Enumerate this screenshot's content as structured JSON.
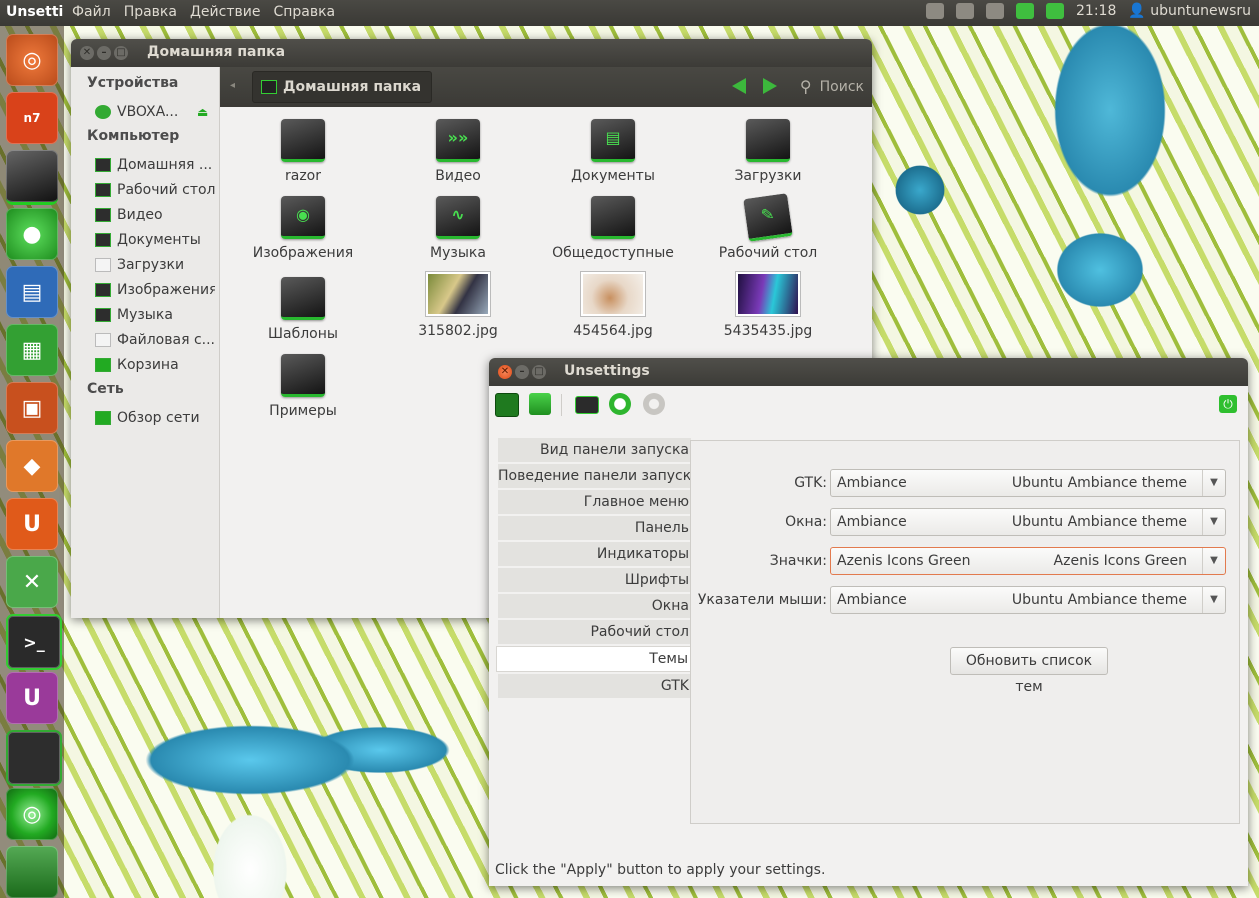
{
  "top_panel": {
    "app_name": "Unsetti",
    "menu": [
      "Файл",
      "Правка",
      "Действие",
      "Справка"
    ],
    "clock": "21:18",
    "user": "ubuntunewsru"
  },
  "launcher": {
    "items": [
      {
        "icon": "ubuntu-dash-icon",
        "label": ""
      },
      {
        "icon": "nexus7-icon",
        "label": "n7"
      },
      {
        "icon": "home-folder-icon",
        "label": ""
      },
      {
        "icon": "browser-icon",
        "label": ""
      },
      {
        "icon": "writer-icon",
        "label": ""
      },
      {
        "icon": "calc-icon",
        "label": ""
      },
      {
        "icon": "impress-icon",
        "label": ""
      },
      {
        "icon": "software-center-icon",
        "label": ""
      },
      {
        "icon": "ubuntu-one-icon",
        "label": "U"
      },
      {
        "icon": "system-settings-icon",
        "label": ""
      },
      {
        "icon": "terminal-icon",
        "label": ">_"
      },
      {
        "icon": "unsettings-icon",
        "label": "U"
      },
      {
        "icon": "workspace-icon",
        "label": ""
      },
      {
        "icon": "dvd-icon",
        "label": ""
      },
      {
        "icon": "trash-icon",
        "label": ""
      }
    ]
  },
  "file_manager": {
    "title": "Домашняя папка",
    "breadcrumb": "Домашняя папка",
    "search_label": "Поиск",
    "sidebar": {
      "devices_header": "Устройства",
      "devices": [
        "VBOXA..."
      ],
      "computer_header": "Компьютер",
      "computer": [
        "Домашняя ...",
        "Рабочий стол",
        "Видео",
        "Документы",
        "Загрузки",
        "Изображения",
        "Музыка",
        "Файловая с...",
        "Корзина"
      ],
      "network_header": "Сеть",
      "network": [
        "Обзор сети"
      ]
    },
    "files": [
      {
        "name": "razor",
        "kind": "folder",
        "glyph": ""
      },
      {
        "name": "Видео",
        "kind": "folder",
        "glyph": "»»"
      },
      {
        "name": "Документы",
        "kind": "folder",
        "glyph": "▤"
      },
      {
        "name": "Загрузки",
        "kind": "folder",
        "glyph": ""
      },
      {
        "name": "Изображения",
        "kind": "folder",
        "glyph": "◉"
      },
      {
        "name": "Музыка",
        "kind": "folder",
        "glyph": "∿"
      },
      {
        "name": "Общедоступные",
        "kind": "folder",
        "glyph": ""
      },
      {
        "name": "Рабочий стол",
        "kind": "folder",
        "glyph": "✎"
      },
      {
        "name": "Шаблоны",
        "kind": "folder",
        "glyph": ""
      },
      {
        "name": "315802.jpg",
        "kind": "image",
        "glyph": ""
      },
      {
        "name": "454564.jpg",
        "kind": "image",
        "glyph": ""
      },
      {
        "name": "5435435.jpg",
        "kind": "image",
        "glyph": ""
      },
      {
        "name": "Примеры",
        "kind": "folder",
        "glyph": ""
      }
    ]
  },
  "unsettings": {
    "title": "Unsettings",
    "categories": [
      "Вид панели запуска",
      "Поведение панели запуска",
      "Главное меню",
      "Панель",
      "Индикаторы",
      "Шрифты",
      "Окна",
      "Рабочий стол",
      "Темы",
      "GTK"
    ],
    "selected_category": "Темы",
    "theme_rows": [
      {
        "label": "GTK:",
        "value": "Ambiance",
        "description": "Ubuntu Ambiance theme"
      },
      {
        "label": "Окна:",
        "value": "Ambiance",
        "description": "Ubuntu Ambiance theme"
      },
      {
        "label": "Значки:",
        "value": "Azenis Icons Green",
        "description": "Azenis Icons Green"
      },
      {
        "label": "Указатели мыши:",
        "value": "Ambiance",
        "description": "Ubuntu Ambiance theme"
      }
    ],
    "refresh_button": "Обновить список тем",
    "status": "Click the \"Apply\" button to apply your settings."
  }
}
